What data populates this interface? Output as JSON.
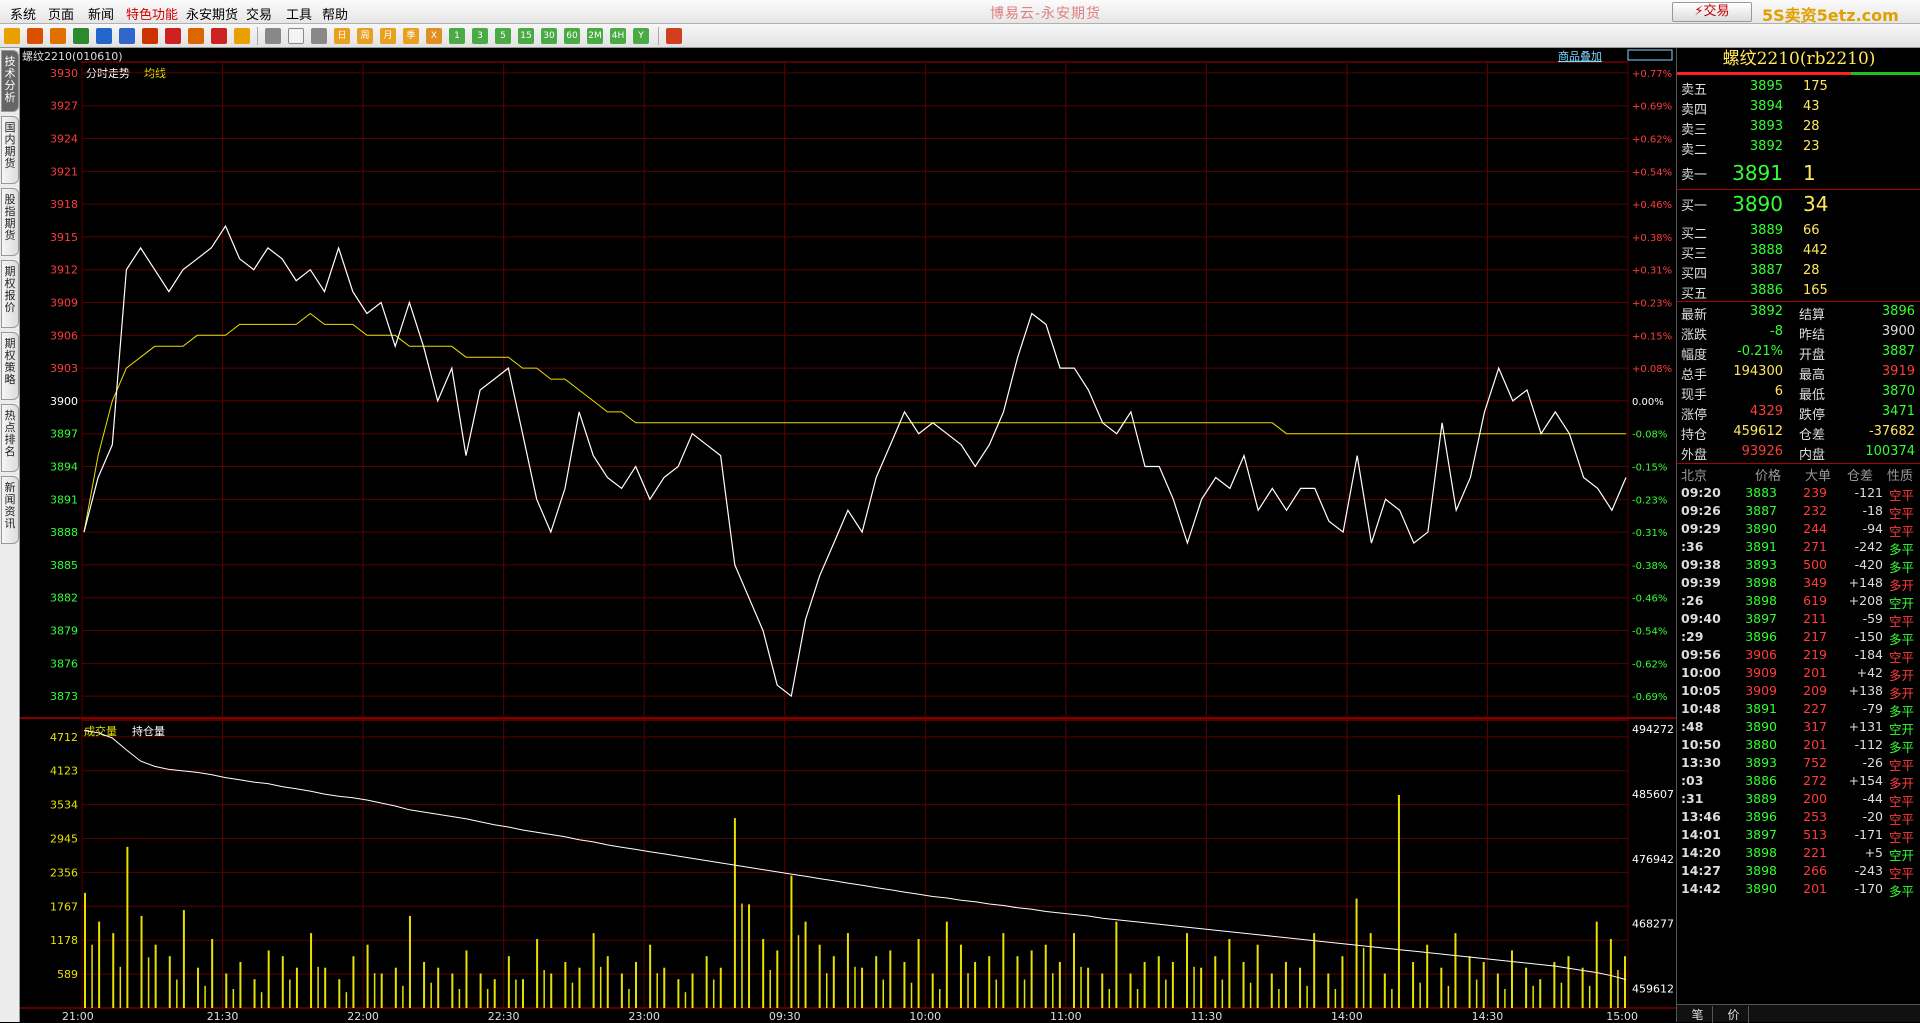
{
  "menu": [
    "系统",
    "页面",
    "新闻",
    "特色功能",
    "永安期货",
    "交易",
    "工具",
    "帮助"
  ],
  "app_title": "博易云-永安期货",
  "trade_button": "⚡交易",
  "watermark": "5S卖资5etz.com",
  "toolbar_labels": [
    "日",
    "周",
    "月",
    "季",
    "X",
    "1",
    "3",
    "5",
    "15",
    "30",
    "60",
    "2M",
    "4H",
    "Y"
  ],
  "sidebar_tabs": [
    "技术分析",
    "国内期货",
    "股指期货",
    "期权报价",
    "期权策略",
    "热点排名",
    "新闻资讯"
  ],
  "chart": {
    "contract_label": "螺纹2210(010610)",
    "top_right_link": "商品叠加",
    "price_labels": {
      "line": "分时走势",
      "avg": "均线"
    },
    "volume_labels": {
      "vol": "成交量",
      "oi": "持仓量"
    },
    "colors": {
      "frame": "#b00000",
      "grid": "#5a0000",
      "price": "#ffffff",
      "avg": "#e8e000",
      "vol": "#e8e000",
      "axis_up": "#ff3c3c",
      "axis_down": "#33ff33"
    }
  },
  "chart_data": {
    "type": "line",
    "title": "分时走势",
    "time_ticks": [
      "21:00",
      "21:30",
      "22:00",
      "22:30",
      "23:00",
      "09:30",
      "10:00",
      "11:00",
      "11:30",
      "14:00",
      "14:30",
      "15:00"
    ],
    "price_ticks": [
      3930,
      3927,
      3924,
      3921,
      3918,
      3915,
      3912,
      3909,
      3906,
      3903,
      3900,
      3897,
      3894,
      3891,
      3888,
      3885,
      3882,
      3879,
      3876,
      3873
    ],
    "pct_ticks": [
      "+0.77%",
      "+0.69%",
      "+0.62%",
      "+0.54%",
      "+0.46%",
      "+0.38%",
      "+0.31%",
      "+0.23%",
      "+0.15%",
      "+0.08%",
      "0.00%",
      "-0.08%",
      "-0.15%",
      "-0.23%",
      "-0.31%",
      "-0.38%",
      "-0.46%",
      "-0.54%",
      "-0.62%",
      "-0.69%"
    ],
    "ylim": [
      3871,
      3931
    ],
    "prev_settle": 3900,
    "price_series": [
      3888,
      3893,
      3896,
      3912,
      3914,
      3912,
      3910,
      3912,
      3913,
      3914,
      3916,
      3913,
      3912,
      3914,
      3913,
      3911,
      3912,
      3910,
      3914,
      3910,
      3908,
      3909,
      3905,
      3909,
      3905,
      3900,
      3903,
      3895,
      3901,
      3902,
      3903,
      3897,
      3891,
      3888,
      3892,
      3899,
      3895,
      3893,
      3892,
      3894,
      3891,
      3893,
      3894,
      3897,
      3896,
      3895,
      3885,
      3882,
      3879,
      3874,
      3873,
      3880,
      3884,
      3887,
      3890,
      3888,
      3893,
      3896,
      3899,
      3897,
      3898,
      3897,
      3896,
      3894,
      3896,
      3899,
      3904,
      3908,
      3907,
      3903,
      3903,
      3901,
      3898,
      3897,
      3899,
      3894,
      3894,
      3891,
      3887,
      3891,
      3893,
      3892,
      3895,
      3890,
      3892,
      3890,
      3892,
      3892,
      3889,
      3888,
      3895,
      3887,
      3891,
      3890,
      3887,
      3888,
      3898,
      3890,
      3893,
      3899,
      3903,
      3900,
      3901,
      3897,
      3899,
      3897,
      3893,
      3892,
      3890,
      3893
    ],
    "avg_series": [
      3888,
      3895,
      3900,
      3903,
      3904,
      3905,
      3905,
      3905,
      3906,
      3906,
      3906,
      3907,
      3907,
      3907,
      3907,
      3907,
      3908,
      3907,
      3907,
      3907,
      3906,
      3906,
      3906,
      3905,
      3905,
      3905,
      3905,
      3904,
      3904,
      3904,
      3904,
      3903,
      3903,
      3902,
      3902,
      3901,
      3900,
      3899,
      3899,
      3898,
      3898,
      3898,
      3898,
      3898,
      3898,
      3898,
      3898,
      3898,
      3898,
      3898,
      3898,
      3898,
      3898,
      3898,
      3898,
      3898,
      3898,
      3898,
      3898,
      3898,
      3898,
      3898,
      3898,
      3898,
      3898,
      3898,
      3898,
      3898,
      3898,
      3898,
      3898,
      3898,
      3898,
      3898,
      3898,
      3898,
      3898,
      3898,
      3898,
      3898,
      3898,
      3898,
      3898,
      3898,
      3898,
      3897,
      3897,
      3897,
      3897,
      3897,
      3897,
      3897,
      3897,
      3897,
      3897,
      3897,
      3897,
      3897,
      3897,
      3897,
      3897,
      3897,
      3897,
      3897,
      3897,
      3897,
      3897,
      3897,
      3897,
      3897
    ],
    "vol_ticks": [
      4712,
      4123,
      3534,
      2945,
      2356,
      1767,
      1178,
      589
    ],
    "oi_ticks": [
      494272,
      485607,
      476942,
      468277,
      459612
    ],
    "vol_ylim": [
      0,
      4900
    ],
    "oi_ylim": [
      457000,
      495500
    ],
    "volume_series": [
      2000,
      1500,
      1300,
      2800,
      1600,
      1100,
      900,
      1700,
      700,
      1200,
      600,
      800,
      500,
      1000,
      900,
      700,
      1300,
      700,
      500,
      900,
      1100,
      600,
      700,
      1600,
      800,
      700,
      600,
      1000,
      600,
      500,
      900,
      500,
      1200,
      600,
      800,
      700,
      1300,
      900,
      600,
      800,
      1100,
      700,
      500,
      600,
      900,
      700,
      3300,
      1800,
      1200,
      1000,
      2300,
      1500,
      1100,
      900,
      1300,
      700,
      900,
      1000,
      800,
      1200,
      600,
      1500,
      1100,
      800,
      900,
      1300,
      900,
      1000,
      1100,
      800,
      1300,
      700,
      600,
      1500,
      600,
      800,
      900,
      800,
      1300,
      700,
      900,
      1200,
      800,
      1100,
      600,
      800,
      700,
      1300,
      600,
      900,
      1900,
      1300,
      600,
      3700,
      800,
      1100,
      700,
      1300,
      900,
      800,
      600,
      1000,
      700,
      500,
      800,
      900,
      700,
      1500,
      1200,
      900
    ],
    "oi_series": [
      494100,
      493800,
      493100,
      491500,
      490000,
      489300,
      488900,
      488700,
      488500,
      488200,
      487800,
      487500,
      487200,
      487000,
      486600,
      486300,
      486000,
      485600,
      485300,
      485100,
      484800,
      484400,
      484000,
      483500,
      483200,
      482900,
      482600,
      482300,
      481900,
      481500,
      481200,
      480800,
      480500,
      480200,
      479900,
      479500,
      479200,
      478800,
      478500,
      478200,
      477900,
      477600,
      477300,
      477000,
      476700,
      476400,
      476100,
      475800,
      475500,
      475200,
      474900,
      474600,
      474300,
      474000,
      473700,
      473400,
      473100,
      472800,
      472500,
      472200,
      471900,
      471700,
      471400,
      471200,
      470900,
      470700,
      470400,
      470200,
      469900,
      469700,
      469500,
      469300,
      469000,
      468800,
      468600,
      468400,
      468200,
      468000,
      467800,
      467600,
      467400,
      467200,
      467000,
      466800,
      466600,
      466400,
      466200,
      466000,
      465800,
      465600,
      465400,
      465200,
      465000,
      464800,
      464600,
      464400,
      464200,
      464000,
      463800,
      463600,
      463400,
      463200,
      463000,
      462800,
      462600,
      462300,
      462000,
      461700,
      461300,
      460800
    ]
  },
  "panel": {
    "title": "螺纹2210(rb2210)",
    "asks": [
      {
        "label": "卖五",
        "price": "3895",
        "vol": "175"
      },
      {
        "label": "卖四",
        "price": "3894",
        "vol": "43"
      },
      {
        "label": "卖三",
        "price": "3893",
        "vol": "28"
      },
      {
        "label": "卖二",
        "price": "3892",
        "vol": "23"
      }
    ],
    "ask1": {
      "label": "卖一",
      "price": "3891",
      "vol": "1"
    },
    "bid1": {
      "label": "买一",
      "price": "3890",
      "vol": "34"
    },
    "bids": [
      {
        "label": "买二",
        "price": "3889",
        "vol": "66"
      },
      {
        "label": "买三",
        "price": "3888",
        "vol": "442"
      },
      {
        "label": "买四",
        "price": "3887",
        "vol": "28"
      },
      {
        "label": "买五",
        "price": "3886",
        "vol": "165"
      }
    ],
    "stats": [
      {
        "l1": "最新",
        "v1": "3892",
        "c1": "g",
        "l2": "结算",
        "v2": "3896",
        "c2": "g"
      },
      {
        "l1": "涨跌",
        "v1": "-8",
        "c1": "g",
        "l2": "昨结",
        "v2": "3900",
        "c2": "w"
      },
      {
        "l1": "幅度",
        "v1": "-0.21%",
        "c1": "g",
        "l2": "开盘",
        "v2": "3887",
        "c2": "g"
      },
      {
        "l1": "总手",
        "v1": "194300",
        "c1": "y",
        "l2": "最高",
        "v2": "3919",
        "c2": "r"
      },
      {
        "l1": "现手",
        "v1": "6",
        "c1": "y",
        "l2": "最低",
        "v2": "3870",
        "c2": "g"
      },
      {
        "l1": "涨停",
        "v1": "4329",
        "c1": "r",
        "l2": "跌停",
        "v2": "3471",
        "c2": "g"
      },
      {
        "l1": "持仓",
        "v1": "459612",
        "c1": "y",
        "l2": "仓差",
        "v2": "-37682",
        "c2": "y"
      },
      {
        "l1": "外盘",
        "v1": "93926",
        "c1": "r",
        "l2": "内盘",
        "v2": "100374",
        "c2": "g"
      }
    ],
    "tick_header": {
      "time": "北京",
      "price": "价格",
      "vol": "大单",
      "diff": "仓差",
      "nature": "性质"
    },
    "ticks": [
      {
        "t": "09:20",
        "p": "3883",
        "v": "239",
        "d": "-121",
        "n": "空平",
        "pc": "g",
        "nc": "r"
      },
      {
        "t": "09:26",
        "p": "3887",
        "v": "232",
        "d": "-18",
        "n": "空平",
        "pc": "g",
        "nc": "r"
      },
      {
        "t": "09:29",
        "p": "3890",
        "v": "244",
        "d": "-94",
        "n": "空平",
        "pc": "g",
        "nc": "r"
      },
      {
        "t": ":36",
        "p": "3891",
        "v": "271",
        "d": "-242",
        "n": "多平",
        "pc": "g",
        "nc": "g"
      },
      {
        "t": "09:38",
        "p": "3893",
        "v": "500",
        "d": "-420",
        "n": "多平",
        "pc": "g",
        "nc": "g"
      },
      {
        "t": "09:39",
        "p": "3898",
        "v": "349",
        "d": "+148",
        "n": "多开",
        "pc": "g",
        "nc": "r"
      },
      {
        "t": ":26",
        "p": "3898",
        "v": "619",
        "d": "+208",
        "n": "空开",
        "pc": "g",
        "nc": "g"
      },
      {
        "t": "09:40",
        "p": "3897",
        "v": "211",
        "d": "-59",
        "n": "空平",
        "pc": "g",
        "nc": "r"
      },
      {
        "t": ":29",
        "p": "3896",
        "v": "217",
        "d": "-150",
        "n": "多平",
        "pc": "g",
        "nc": "g"
      },
      {
        "t": "09:56",
        "p": "3906",
        "v": "219",
        "d": "-184",
        "n": "空平",
        "pc": "r",
        "nc": "r"
      },
      {
        "t": "10:00",
        "p": "3909",
        "v": "201",
        "d": "+42",
        "n": "多开",
        "pc": "r",
        "nc": "r"
      },
      {
        "t": "10:05",
        "p": "3909",
        "v": "209",
        "d": "+138",
        "n": "多开",
        "pc": "r",
        "nc": "r"
      },
      {
        "t": "10:48",
        "p": "3891",
        "v": "227",
        "d": "-79",
        "n": "多平",
        "pc": "g",
        "nc": "g"
      },
      {
        "t": ":48",
        "p": "3890",
        "v": "317",
        "d": "+131",
        "n": "空开",
        "pc": "g",
        "nc": "g"
      },
      {
        "t": "10:50",
        "p": "3880",
        "v": "201",
        "d": "-112",
        "n": "多平",
        "pc": "g",
        "nc": "g"
      },
      {
        "t": "13:30",
        "p": "3893",
        "v": "752",
        "d": "-26",
        "n": "空平",
        "pc": "g",
        "nc": "r"
      },
      {
        "t": ":03",
        "p": "3886",
        "v": "272",
        "d": "+154",
        "n": "多开",
        "pc": "g",
        "nc": "r"
      },
      {
        "t": ":31",
        "p": "3889",
        "v": "200",
        "d": "-44",
        "n": "空平",
        "pc": "g",
        "nc": "r"
      },
      {
        "t": "13:46",
        "p": "3896",
        "v": "253",
        "d": "-20",
        "n": "空平",
        "pc": "g",
        "nc": "r"
      },
      {
        "t": "14:01",
        "p": "3897",
        "v": "513",
        "d": "-171",
        "n": "空平",
        "pc": "g",
        "nc": "r"
      },
      {
        "t": "14:20",
        "p": "3898",
        "v": "221",
        "d": "+5",
        "n": "空开",
        "pc": "g",
        "nc": "g"
      },
      {
        "t": "14:27",
        "p": "3898",
        "v": "266",
        "d": "-243",
        "n": "空平",
        "pc": "g",
        "nc": "r"
      },
      {
        "t": "14:42",
        "p": "3890",
        "v": "201",
        "d": "-170",
        "n": "多平",
        "pc": "g",
        "nc": "g"
      }
    ],
    "bottom_tabs": [
      "笔",
      "价"
    ]
  }
}
